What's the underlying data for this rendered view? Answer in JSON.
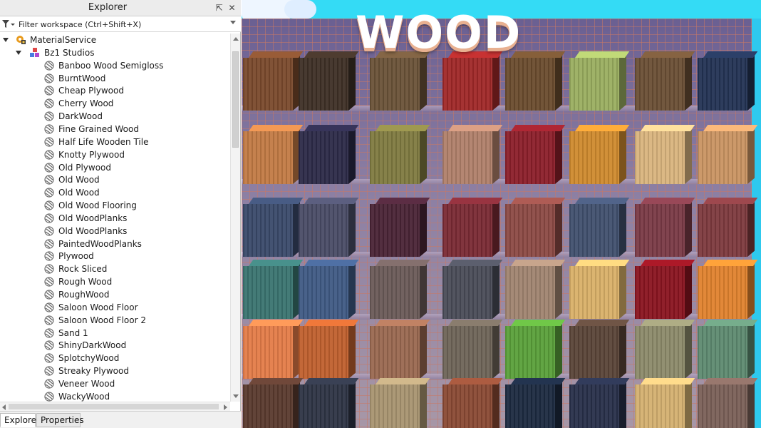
{
  "explorer": {
    "title": "Explorer",
    "pin_glyph": "⇱",
    "close_glyph": "✕",
    "filter_placeholder": "Filter workspace (Ctrl+Shift+X)"
  },
  "tree": {
    "root": {
      "label": "MaterialService",
      "icon": "material-service-icon"
    },
    "folder": {
      "label": "Bz1 Studios",
      "icon": "model-icon"
    },
    "items": [
      "Banboo Wood Semigloss",
      "BurntWood",
      "Cheap Plywood",
      "Cherry Wood",
      "DarkWood",
      "Fine Grained Wood",
      "Half Life Wooden Tile",
      "Knotty Plywood",
      "Old Plywood",
      "Old Wood",
      "Old Wood",
      "Old Wood Flooring",
      "Old WoodPlanks",
      "Old WoodPlanks",
      "PaintedWoodPlanks",
      "Plywood",
      "Rock Sliced",
      "Rough Wood",
      "RoughWood",
      "Saloon Wood Floor",
      "Saloon Wood Floor 2",
      "Sand 1",
      "ShinyDarkWood",
      "SplotchyWood",
      "Streaky Plywood",
      "Veneer Wood",
      "WackyWood"
    ]
  },
  "tabs": [
    {
      "label": "Explorer",
      "active": true
    },
    {
      "label": "Properties",
      "active": false
    }
  ],
  "viewport": {
    "sign_text": "WOOD",
    "cube_rows": [
      [
        "#7a4a2c",
        "#3e3026",
        "#6a5238",
        "#a02828",
        "#6b4c2e",
        "#9aae60",
        "#6b4f35",
        "#233354"
      ],
      [
        "#c27a44",
        "#2c2a48",
        "#7f7a40",
        "#b0806a",
        "#8c1f2a",
        "#cf8a2e",
        "#d9b47e",
        "#c99462"
      ],
      [
        "#3a4a6a",
        "#4a4c66",
        "#4a2436",
        "#7a2a34",
        "#8c4a44",
        "#41506e",
        "#7a3a46",
        "#7e3a3e"
      ],
      [
        "#3a7470",
        "#3f5a84",
        "#6a5a58",
        "#4a4c58",
        "#a08470",
        "#d9b068",
        "#8a1420",
        "#e0822e"
      ],
      [
        "#e47c48",
        "#c0602e",
        "#9a6850",
        "#6e6458",
        "#5aa03a",
        "#5a4438",
        "#8c8a6a",
        "#5e8a70"
      ],
      [
        "#5a3a2e",
        "#2e3444",
        "#a89470",
        "#8a4a34",
        "#1c2a40",
        "#28304a",
        "#d4b070",
        "#7a6058"
      ]
    ]
  }
}
